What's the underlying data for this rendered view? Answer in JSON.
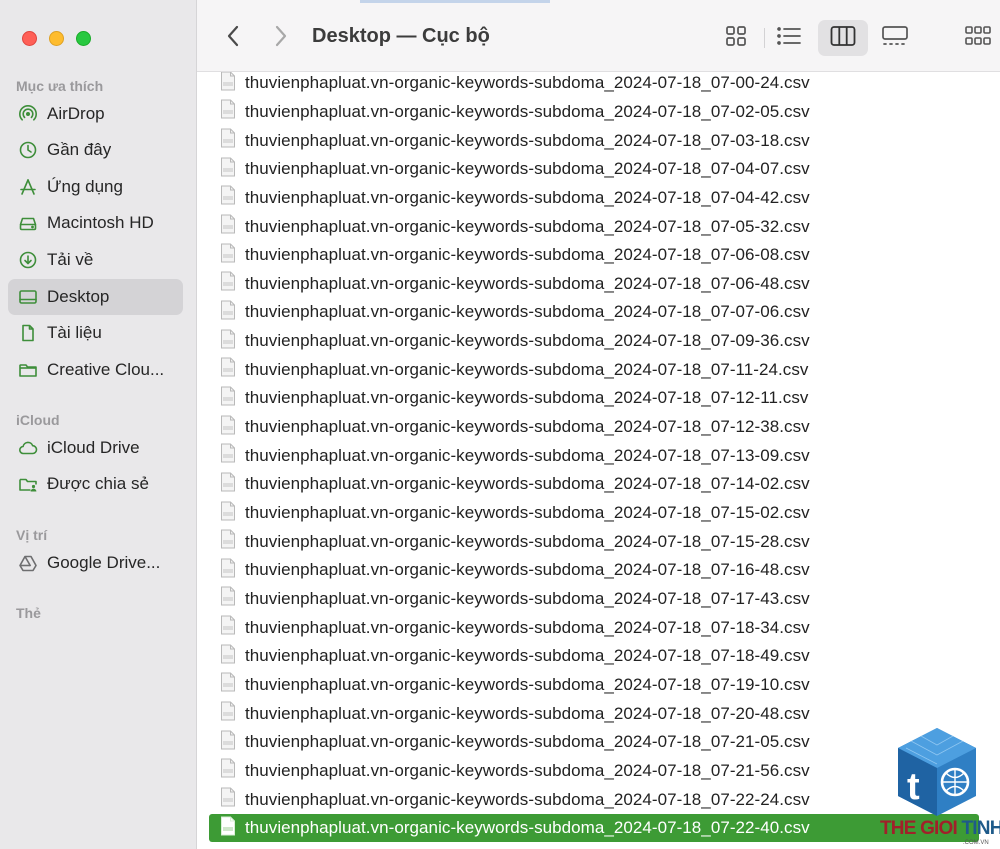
{
  "window": {
    "title": "Desktop — Cục bộ"
  },
  "sidebar": {
    "sections": [
      {
        "title": "Mục ưa thích",
        "items": [
          {
            "label": "AirDrop",
            "icon": "airdrop-icon"
          },
          {
            "label": "Gần đây",
            "icon": "clock-icon"
          },
          {
            "label": "Ứng dụng",
            "icon": "applications-icon"
          },
          {
            "label": "Macintosh HD",
            "icon": "harddrive-icon"
          },
          {
            "label": "Tải về",
            "icon": "download-icon"
          },
          {
            "label": "Desktop",
            "icon": "desktop-icon",
            "selected": true
          },
          {
            "label": "Tài liệu",
            "icon": "document-icon"
          },
          {
            "label": "Creative Clou...",
            "icon": "folder-icon"
          }
        ]
      },
      {
        "title": "iCloud",
        "items": [
          {
            "label": "iCloud Drive",
            "icon": "cloud-icon"
          },
          {
            "label": "Được chia sẻ",
            "icon": "shared-folder-icon"
          }
        ]
      },
      {
        "title": "Vị trí",
        "items": [
          {
            "label": "Google Drive...",
            "icon": "google-drive-icon"
          }
        ]
      },
      {
        "title": "Thẻ",
        "items": []
      }
    ]
  },
  "files": [
    "thuvienphapluat.vn-organic-keywords-subdoma_2024-07-18_07-00-24.csv",
    "thuvienphapluat.vn-organic-keywords-subdoma_2024-07-18_07-02-05.csv",
    "thuvienphapluat.vn-organic-keywords-subdoma_2024-07-18_07-03-18.csv",
    "thuvienphapluat.vn-organic-keywords-subdoma_2024-07-18_07-04-07.csv",
    "thuvienphapluat.vn-organic-keywords-subdoma_2024-07-18_07-04-42.csv",
    "thuvienphapluat.vn-organic-keywords-subdoma_2024-07-18_07-05-32.csv",
    "thuvienphapluat.vn-organic-keywords-subdoma_2024-07-18_07-06-08.csv",
    "thuvienphapluat.vn-organic-keywords-subdoma_2024-07-18_07-06-48.csv",
    "thuvienphapluat.vn-organic-keywords-subdoma_2024-07-18_07-07-06.csv",
    "thuvienphapluat.vn-organic-keywords-subdoma_2024-07-18_07-09-36.csv",
    "thuvienphapluat.vn-organic-keywords-subdoma_2024-07-18_07-11-24.csv",
    "thuvienphapluat.vn-organic-keywords-subdoma_2024-07-18_07-12-11.csv",
    "thuvienphapluat.vn-organic-keywords-subdoma_2024-07-18_07-12-38.csv",
    "thuvienphapluat.vn-organic-keywords-subdoma_2024-07-18_07-13-09.csv",
    "thuvienphapluat.vn-organic-keywords-subdoma_2024-07-18_07-14-02.csv",
    "thuvienphapluat.vn-organic-keywords-subdoma_2024-07-18_07-15-02.csv",
    "thuvienphapluat.vn-organic-keywords-subdoma_2024-07-18_07-15-28.csv",
    "thuvienphapluat.vn-organic-keywords-subdoma_2024-07-18_07-16-48.csv",
    "thuvienphapluat.vn-organic-keywords-subdoma_2024-07-18_07-17-43.csv",
    "thuvienphapluat.vn-organic-keywords-subdoma_2024-07-18_07-18-34.csv",
    "thuvienphapluat.vn-organic-keywords-subdoma_2024-07-18_07-18-49.csv",
    "thuvienphapluat.vn-organic-keywords-subdoma_2024-07-18_07-19-10.csv",
    "thuvienphapluat.vn-organic-keywords-subdoma_2024-07-18_07-20-48.csv",
    "thuvienphapluat.vn-organic-keywords-subdoma_2024-07-18_07-21-05.csv",
    "thuvienphapluat.vn-organic-keywords-subdoma_2024-07-18_07-21-56.csv",
    "thuvienphapluat.vn-organic-keywords-subdoma_2024-07-18_07-22-24.csv",
    "thuvienphapluat.vn-organic-keywords-subdoma_2024-07-18_07-22-40.csv"
  ],
  "selected_file_index": 26,
  "watermark": {
    "part1": "THE GIOI ",
    "part2": "TINHOC",
    "sub": ".COM.VN"
  },
  "colors": {
    "sidebar_icon": "#3e8e3a",
    "selection": "#3d9b35",
    "close": "#fe5f57",
    "minimize": "#febc2e",
    "maximize": "#28c840"
  }
}
